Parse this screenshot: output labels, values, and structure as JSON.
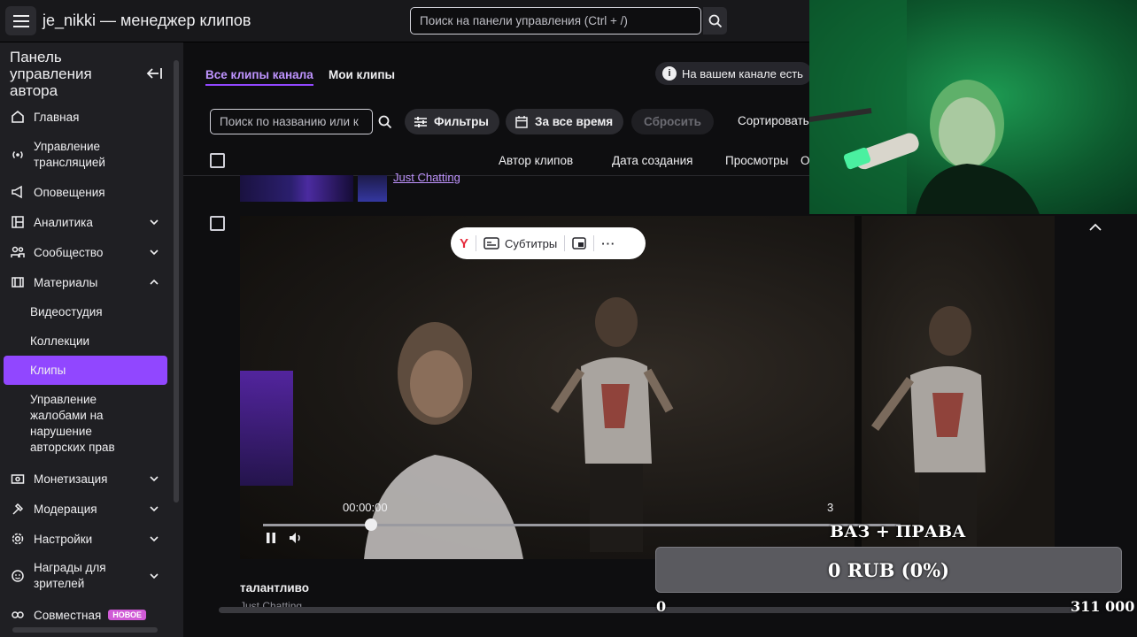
{
  "header": {
    "app_title": "je_nikki — менеджер клипов",
    "search_placeholder": "Поиск на панели управления (Ctrl + /)"
  },
  "sidebar": {
    "title": "Панель управления автора",
    "items": [
      {
        "label": "Главная",
        "icon": "home-icon"
      },
      {
        "label": "Управление трансляцией",
        "icon": "broadcast-icon"
      },
      {
        "label": "Оповещения",
        "icon": "megaphone-icon"
      },
      {
        "label": "Аналитика",
        "icon": "analytics-icon"
      },
      {
        "label": "Сообщество",
        "icon": "community-icon"
      },
      {
        "label": "Материалы",
        "icon": "content-icon"
      },
      {
        "label": "Монетизация",
        "icon": "monetization-icon"
      },
      {
        "label": "Модерация",
        "icon": "moderation-icon"
      },
      {
        "label": "Настройки",
        "icon": "gear-icon"
      },
      {
        "label": "Награды для зрителей",
        "icon": "rewards-icon"
      },
      {
        "label": "Совместная",
        "icon": "collab-icon",
        "badge": "НОВОЕ"
      }
    ],
    "sub_items": [
      "Видеостудия",
      "Коллекции",
      "Клипы",
      "Управление жалобами на нарушение авторских прав"
    ],
    "active_sub_item": "Клипы"
  },
  "main": {
    "tabs": [
      "Все клипы канала",
      "Мои клипы"
    ],
    "active_tab": "Все клипы канала",
    "info_text": "На вашем канале есть",
    "clip_search_placeholder": "Поиск по названию или к",
    "filter_button": "Фильтры",
    "period_button": "За все время",
    "reset_button": "Сбросить",
    "sort_label": "Сортировать",
    "columns": [
      "Автор клипов",
      "Дата создания",
      "Просмотры",
      "О"
    ],
    "prev_clip_category": "Just Chatting",
    "video_toolbar": {
      "subtitles_label": "Субтитры"
    },
    "player": {
      "current_time": "00:00:00",
      "duration_fragment": "3",
      "progress": 0.17
    },
    "clip_title": "талантливо",
    "clip_category": "Just Chatting"
  },
  "overlay": {
    "goal_title": "ВАЗ + ПРАВА",
    "goal_value": "0 RUB (0%)",
    "goal_min": "0",
    "goal_max": "311 000",
    "goal_progress": 0
  },
  "colors": {
    "accent": "#9147ff",
    "link": "#bf94ff",
    "background": "#0e0e10"
  }
}
